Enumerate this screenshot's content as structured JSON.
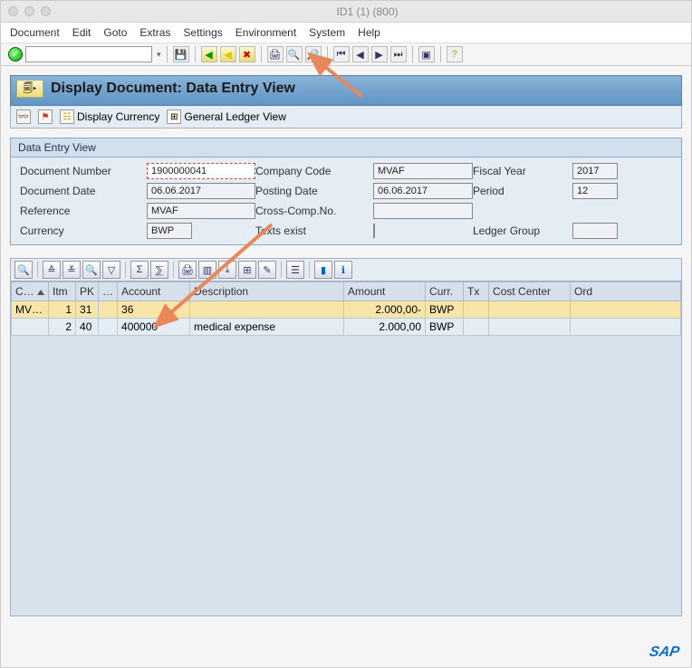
{
  "window": {
    "title": "ID1 (1) (800)"
  },
  "menu": [
    "Document",
    "Edit",
    "Goto",
    "Extras",
    "Settings",
    "Environment",
    "System",
    "Help"
  ],
  "page": {
    "title": "Display Document: Data Entry View"
  },
  "app_toolbar": {
    "display_currency": "Display Currency",
    "gl_view": "General Ledger View"
  },
  "panel": {
    "title": "Data Entry View",
    "labels": {
      "doc_no": "Document Number",
      "company": "Company Code",
      "fyear": "Fiscal Year",
      "doc_date": "Document Date",
      "post_date": "Posting Date",
      "period": "Period",
      "reference": "Reference",
      "cross": "Cross-Comp.No.",
      "currency": "Currency",
      "texts_exist": "Texts exist",
      "ledger_group": "Ledger Group"
    },
    "values": {
      "doc_no": "1900000041",
      "company": "MVAF",
      "fyear": "2017",
      "doc_date": "06.06.2017",
      "post_date": "06.06.2017",
      "period": "12",
      "reference": "MVAF",
      "cross": "",
      "currency": "BWP",
      "ledger_group": ""
    }
  },
  "grid": {
    "columns": [
      "C…",
      "Itm",
      "PK",
      "…",
      "Account",
      "Description",
      "Amount",
      "Curr.",
      "Tx",
      "Cost Center",
      "Ord"
    ],
    "rows": [
      {
        "c": "MV…",
        "itm": "1",
        "pk": "31",
        "s": "",
        "account": "36",
        "desc": "",
        "amount": "2.000,00-",
        "curr": "BWP",
        "tx": "",
        "costcenter": "",
        "ord": ""
      },
      {
        "c": "",
        "itm": "2",
        "pk": "40",
        "s": "",
        "account": "400000",
        "desc": "medical expense",
        "amount": "2.000,00",
        "curr": "BWP",
        "tx": "",
        "costcenter": "",
        "ord": ""
      }
    ]
  },
  "logo": "SAP"
}
